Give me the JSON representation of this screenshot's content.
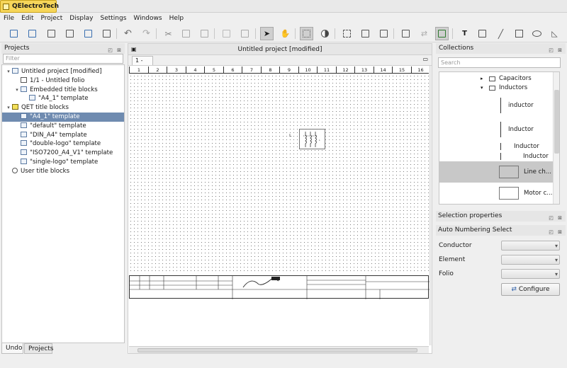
{
  "app": {
    "title": "QElectroTech"
  },
  "menu": [
    "File",
    "Edit",
    "Project",
    "Display",
    "Settings",
    "Windows",
    "Help"
  ],
  "toolbar": {
    "icons": [
      "new-project-icon",
      "open-icon",
      "save-icon",
      "save-as-icon",
      "open-folder-icon",
      "print-icon",
      "undo-icon",
      "redo-icon",
      "cut-icon",
      "copy-icon",
      "paste-icon",
      "delete-icon",
      "rotate-icon",
      "select-pointer-icon",
      "pan-hand-icon",
      "grid-icon",
      "color-toggle-icon",
      "select-rect-icon",
      "zoom-fit-icon",
      "zoom-full-icon",
      "terminal-strip-icon",
      "conductor-icon",
      "terminal-active-icon",
      "text-icon",
      "image-icon",
      "line-icon",
      "rectangle-icon",
      "ellipse-icon",
      "polygon-icon"
    ]
  },
  "left": {
    "title": "Projects",
    "filter_placeholder": "Filter",
    "tree": [
      {
        "label": "Untitled project [modified]",
        "level": 0,
        "arrow": "▾",
        "icon": "project"
      },
      {
        "label": "1/1 - Untitled folio",
        "level": 1,
        "arrow": "",
        "icon": "doc"
      },
      {
        "label": "Embedded title blocks",
        "level": 1,
        "arrow": "▾",
        "icon": "project"
      },
      {
        "label": "\"A4_1\" template",
        "level": 2,
        "arrow": "",
        "icon": "project"
      },
      {
        "label": "QET title blocks",
        "level": 0,
        "arrow": "▾",
        "icon": "qet"
      },
      {
        "label": "\"A4_1\" template",
        "level": 1,
        "arrow": "",
        "icon": "project",
        "selected": true
      },
      {
        "label": "\"default\" template",
        "level": 1,
        "arrow": "",
        "icon": "project"
      },
      {
        "label": "\"DIN_A4\" template",
        "level": 1,
        "arrow": "",
        "icon": "project"
      },
      {
        "label": "\"double-logo\" template",
        "level": 1,
        "arrow": "",
        "icon": "project"
      },
      {
        "label": "\"ISO7200_A4_V1\" template",
        "level": 1,
        "arrow": "",
        "icon": "project"
      },
      {
        "label": "\"single-logo\" template",
        "level": 1,
        "arrow": "",
        "icon": "project"
      },
      {
        "label": "User title blocks",
        "level": 0,
        "arrow": "",
        "icon": "user"
      }
    ],
    "bottom_tabs": [
      "Undo",
      "Projects"
    ]
  },
  "center": {
    "title": "Untitled project [modified]",
    "folio_tab": "1 -",
    "ruler": [
      "1",
      "2",
      "3",
      "4",
      "5",
      "6",
      "7",
      "8",
      "9",
      "10",
      "11",
      "12",
      "13",
      "14",
      "15",
      "16"
    ]
  },
  "right": {
    "collections_title": "Collections",
    "search_placeholder": "Search",
    "items": [
      {
        "label": "Capacitors",
        "kind": "folder",
        "arrow": "▸"
      },
      {
        "label": "Inductors",
        "kind": "folder",
        "arrow": "▾"
      },
      {
        "label": "inductor",
        "kind": "element"
      },
      {
        "label": "Inductor",
        "kind": "element"
      },
      {
        "label": "Inductor",
        "kind": "element"
      },
      {
        "label": "Inductor",
        "kind": "element"
      },
      {
        "label": "Line ch...",
        "kind": "element",
        "selected": true
      },
      {
        "label": "Motor c...",
        "kind": "element"
      }
    ],
    "selection_properties": "Selection properties",
    "auto_numbering": "Auto Numbering Select",
    "form": {
      "conductor": "Conductor",
      "element": "Element",
      "folio": "Folio"
    },
    "configure": "Configure"
  }
}
